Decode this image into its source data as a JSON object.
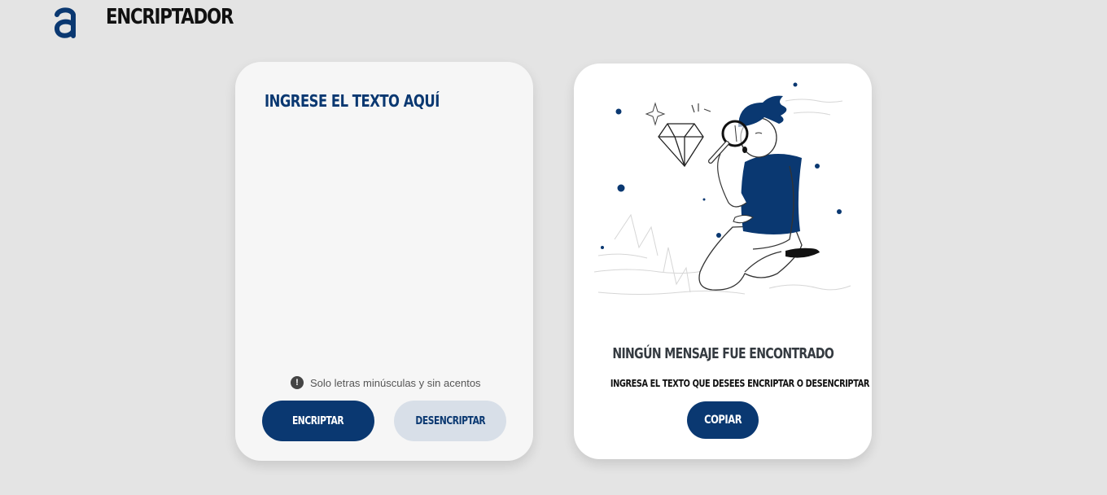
{
  "header": {
    "app_title": "ENCRIPTADOR",
    "logo_icon": "alura-a-logo-icon"
  },
  "input_panel": {
    "placeholder": "INGRESE EL TEXTO AQUÍ",
    "value": "",
    "hint_text": "Solo letras minúsculas y sin acentos",
    "hint_icon": "exclamation-circle-icon",
    "encrypt_label": "ENCRIPTAR",
    "decrypt_label": "DESENCRIPTAR"
  },
  "output_panel": {
    "illustration": "person-with-magnifying-glass-diamond",
    "title": "NINGÚN MENSAJE FUE ENCONTRADO",
    "subtitle": "INGRESA EL TEXTO QUE DESEES ENCRIPTAR O DESENCRIPTAR",
    "copy_label": "COPIAR"
  },
  "colors": {
    "primary": "#0a3871",
    "background": "#e4e4e4",
    "secondary_button": "#d8dfe8",
    "input_card": "#f6f6f6",
    "output_card": "#ffffff"
  }
}
